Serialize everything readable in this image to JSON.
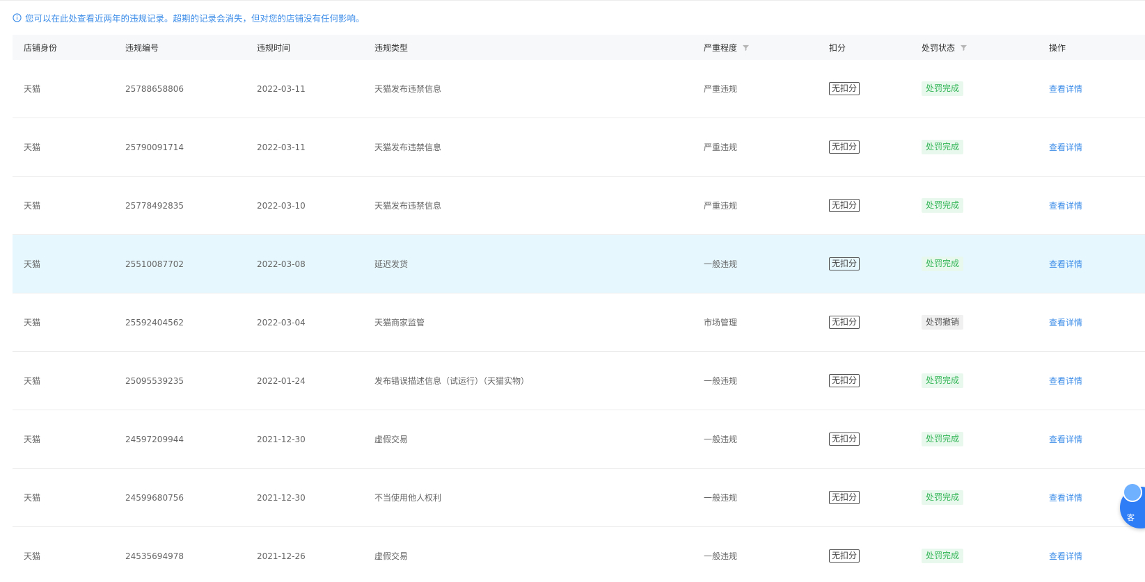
{
  "notice": {
    "text": "您可以在此处查看近两年的违规记录。超期的记录会消失，但对您的店铺没有任何影响。"
  },
  "table": {
    "columns": {
      "identity": "店铺身份",
      "id": "违规编号",
      "time": "违规时间",
      "type": "违规类型",
      "severity": "严重程度",
      "deduct": "扣分",
      "status": "处罚状态",
      "action": "操作"
    },
    "rows": [
      {
        "identity": "天猫",
        "id": "25788658806",
        "time": "2022-03-11",
        "type": "天猫发布违禁信息",
        "severity": "严重违规",
        "deduct": "无扣分",
        "status": "处罚完成",
        "action": "查看详情"
      },
      {
        "identity": "天猫",
        "id": "25790091714",
        "time": "2022-03-11",
        "type": "天猫发布违禁信息",
        "severity": "严重违规",
        "deduct": "无扣分",
        "status": "处罚完成",
        "action": "查看详情"
      },
      {
        "identity": "天猫",
        "id": "25778492835",
        "time": "2022-03-10",
        "type": "天猫发布违禁信息",
        "severity": "严重违规",
        "deduct": "无扣分",
        "status": "处罚完成",
        "action": "查看详情"
      },
      {
        "identity": "天猫",
        "id": "25510087702",
        "time": "2022-03-08",
        "type": "延迟发货",
        "severity": "一般违规",
        "deduct": "无扣分",
        "status": "处罚完成",
        "action": "查看详情"
      },
      {
        "identity": "天猫",
        "id": "25592404562",
        "time": "2022-03-04",
        "type": "天猫商家监管",
        "severity": "市场管理",
        "deduct": "无扣分",
        "status": "处罚撤销",
        "action": "查看详情"
      },
      {
        "identity": "天猫",
        "id": "25095539235",
        "time": "2022-01-24",
        "type": "发布错误描述信息（试运行）（天猫实物）",
        "severity": "一般违规",
        "deduct": "无扣分",
        "status": "处罚完成",
        "action": "查看详情"
      },
      {
        "identity": "天猫",
        "id": "24597209944",
        "time": "2021-12-30",
        "type": "虚假交易",
        "severity": "一般违规",
        "deduct": "无扣分",
        "status": "处罚完成",
        "action": "查看详情"
      },
      {
        "identity": "天猫",
        "id": "24599680756",
        "time": "2021-12-30",
        "type": "不当使用他人权利",
        "severity": "一般违规",
        "deduct": "无扣分",
        "status": "处罚完成",
        "action": "查看详情"
      },
      {
        "identity": "天猫",
        "id": "24535694978",
        "time": "2021-12-26",
        "type": "虚假交易",
        "severity": "一般违规",
        "deduct": "无扣分",
        "status": "处罚完成",
        "action": "查看详情"
      }
    ]
  },
  "assistant": {
    "label": "客"
  },
  "colors": {
    "link": "#3d8de8",
    "status_done_bg": "#e8f8ec",
    "status_done_text": "#32b556",
    "status_revoked_bg": "#f0f0f0",
    "highlight_row": "#e6f7fd",
    "header_bg": "#f7f8fa"
  }
}
